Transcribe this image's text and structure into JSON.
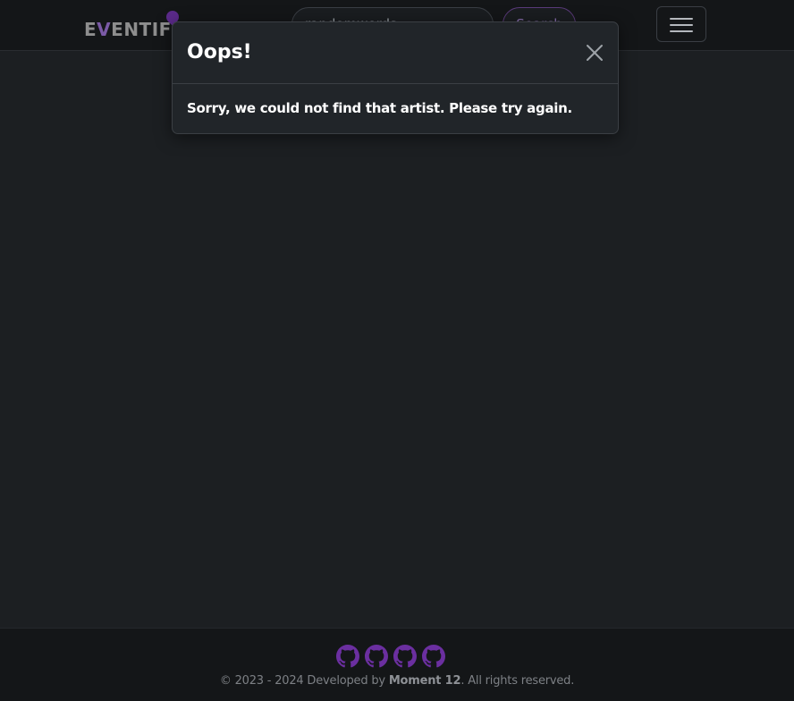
{
  "navbar": {
    "logo_text_main": "ENTIF",
    "logo_text_accent": "V",
    "logo_text_prefix": "E",
    "search": {
      "value": "randomwords",
      "placeholder": "Search"
    },
    "search_button_label": "Search"
  },
  "modal": {
    "title": "Oops!",
    "body": "Sorry, we could not find that artist. Please try again."
  },
  "footer": {
    "social_icons": [
      "github-icon",
      "github-icon",
      "github-icon",
      "github-icon"
    ],
    "copyright_prefix": "© 2023 - 2024 Developed by ",
    "developer": "Moment 12",
    "copyright_suffix": ". All rights reserved."
  },
  "colors": {
    "background": "#1c1f22",
    "navbar": "#141618",
    "modal": "#212529",
    "accent_purple": "#5b2a8a",
    "icon_purple": "#6b2fa0"
  }
}
